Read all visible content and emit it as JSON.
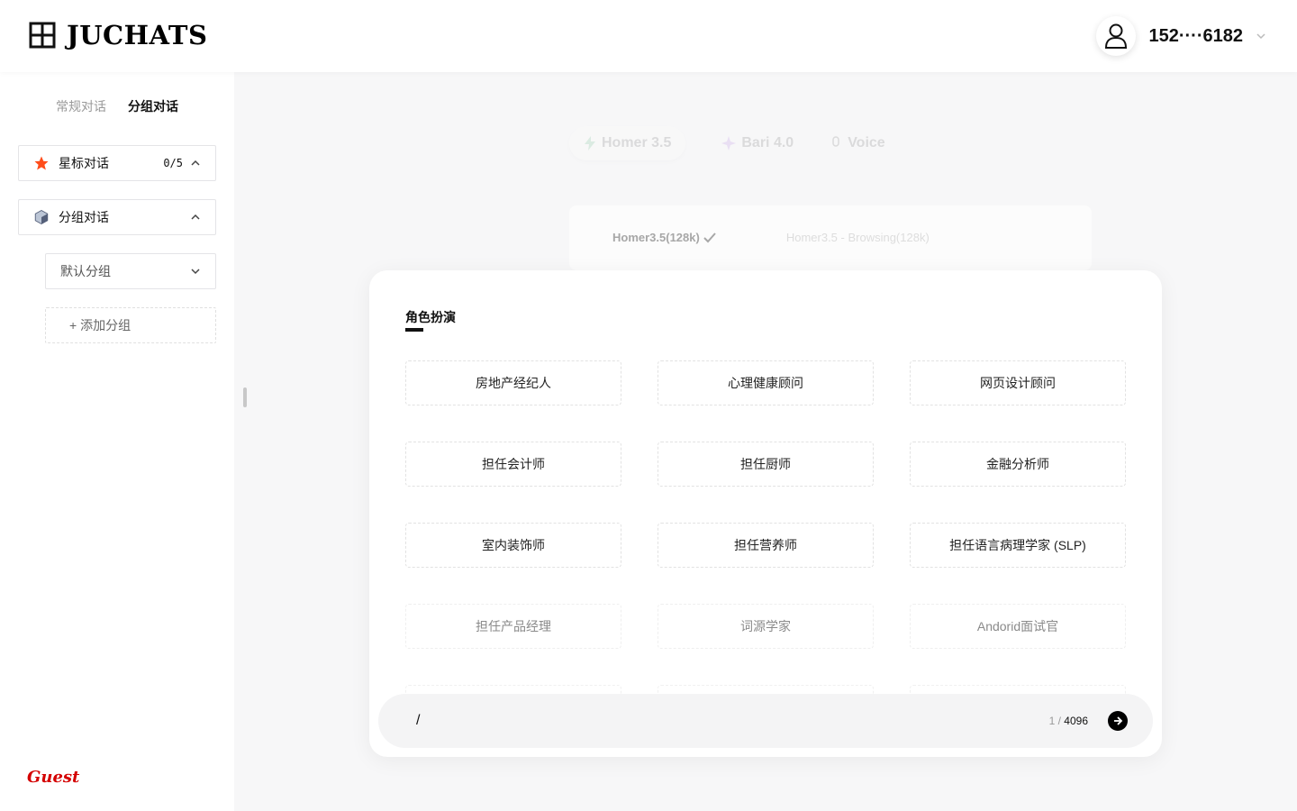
{
  "app": {
    "logo_text": "JUCHATS",
    "phone": "152····6182"
  },
  "sidebar": {
    "tabs": [
      {
        "label": "常规对话",
        "active": false
      },
      {
        "label": "分组对话",
        "active": true
      }
    ],
    "starred": {
      "label": "星标对话",
      "count": "0/5"
    },
    "groups": {
      "label": "分组对话"
    },
    "default_group": {
      "label": "默认分组"
    },
    "add_group": {
      "label": "+ 添加分组"
    },
    "guest": "Guest"
  },
  "models": {
    "items": [
      "Homer 3.5",
      "Bari 4.0",
      "Voice"
    ],
    "submodels": [
      "Homer3.5(128k)",
      "Homer3.5 - Browsing(128k)"
    ]
  },
  "roles": {
    "title": "角色扮演",
    "items": [
      "房地产经纪人",
      "心理健康顾问",
      "网页设计顾问",
      "担任会计师",
      "担任厨师",
      "金融分析师",
      "室内装饰师",
      "担任营养师",
      "担任语言病理学家 (SLP)",
      "担任产品经理",
      "词源学家",
      "Andorid面试官"
    ]
  },
  "input": {
    "value": "/",
    "count_current": "1",
    "count_sep": " / ",
    "count_max": "4096"
  },
  "colors": {
    "accent": "#000000",
    "star": "#ff4d1a",
    "guest": "#d40000"
  }
}
